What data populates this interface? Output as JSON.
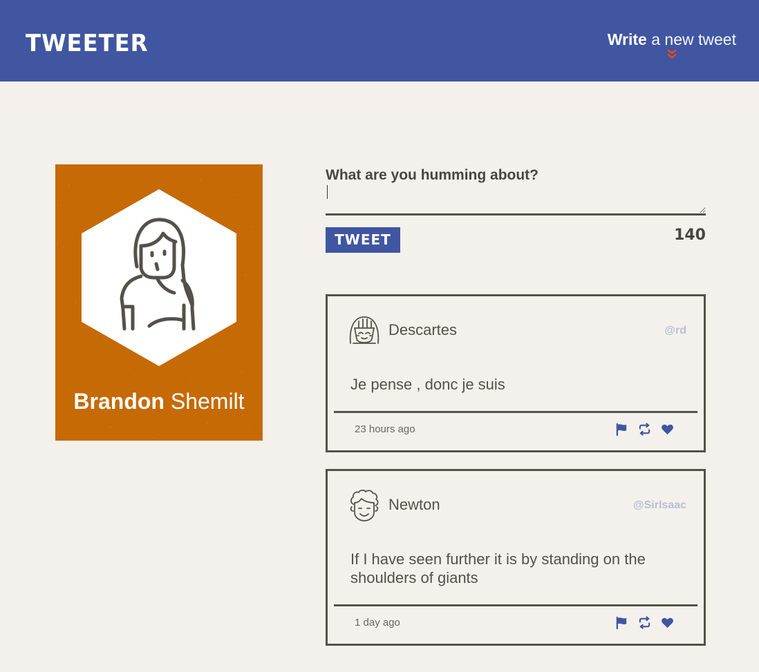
{
  "nav": {
    "brand": "TWEETER",
    "compose_strong": "Write",
    "compose_rest": "a new tweet"
  },
  "profile": {
    "first_name": "Brandon",
    "last_name": "Shemilt"
  },
  "compose": {
    "label": "What are you humming about?",
    "value": "",
    "placeholder": "",
    "button_label": "TWEET",
    "counter": "140"
  },
  "tweets": [
    {
      "name": "Descartes",
      "handle": "@rd",
      "content": "Je pense , donc je suis",
      "time": "23 hours ago",
      "avatar_icon": "girl-avatar-icon"
    },
    {
      "name": "Newton",
      "handle": "@SirIsaac",
      "content": "If I have seen further it is by standing on the shoulders of giants",
      "time": "1 day ago",
      "avatar_icon": "curly-hair-avatar-icon"
    }
  ],
  "colors": {
    "nav_bg": "#4056a1",
    "page_bg": "#f4f1ec",
    "profile_bg": "#c66a05",
    "accent": "#e8491d",
    "handle": "#b6bfd8",
    "border": "#545149"
  }
}
